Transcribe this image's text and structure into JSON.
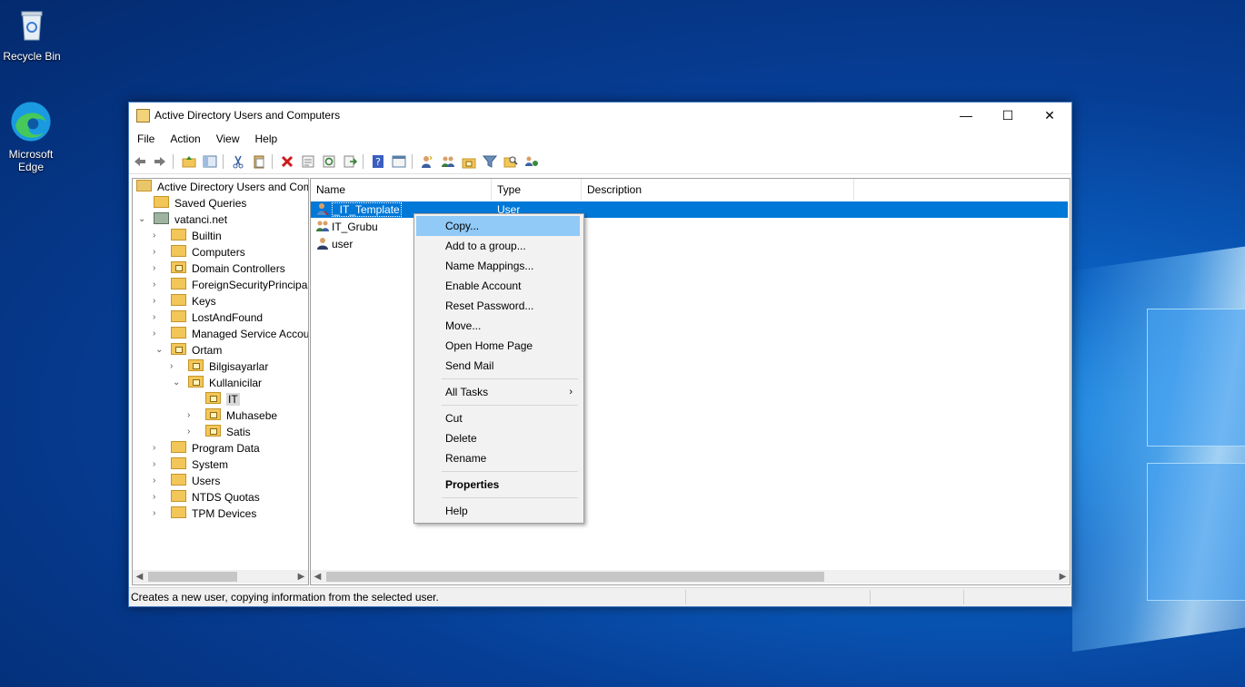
{
  "desktop": {
    "icons": [
      {
        "label": "Recycle Bin",
        "icon": "recycle-bin-icon"
      },
      {
        "label": "Microsoft Edge",
        "icon": "edge-icon"
      }
    ]
  },
  "window": {
    "title": "Active Directory Users and Computers",
    "controls": {
      "minimize": "—",
      "maximize": "☐",
      "close": "✕"
    }
  },
  "menu": [
    "File",
    "Action",
    "View",
    "Help"
  ],
  "tree": {
    "root": "Active Directory Users and Com",
    "items": [
      {
        "label": "Saved Queries"
      },
      {
        "label": "vatanci.net"
      },
      {
        "label": "Builtin"
      },
      {
        "label": "Computers"
      },
      {
        "label": "Domain Controllers"
      },
      {
        "label": "ForeignSecurityPrincipals"
      },
      {
        "label": "Keys"
      },
      {
        "label": "LostAndFound"
      },
      {
        "label": "Managed Service Accoun"
      },
      {
        "label": "Ortam"
      },
      {
        "label": "Bilgisayarlar"
      },
      {
        "label": "Kullanicilar"
      },
      {
        "label": "IT"
      },
      {
        "label": "Muhasebe"
      },
      {
        "label": "Satis"
      },
      {
        "label": "Program Data"
      },
      {
        "label": "System"
      },
      {
        "label": "Users"
      },
      {
        "label": "NTDS Quotas"
      },
      {
        "label": "TPM Devices"
      }
    ]
  },
  "list": {
    "columns": [
      "Name",
      "Type",
      "Description"
    ],
    "rows": [
      {
        "name": "_IT_Template",
        "type": "User",
        "description": ""
      },
      {
        "name": "IT_Grubu",
        "type": "",
        "description": ""
      },
      {
        "name": "user",
        "type": "",
        "description": ""
      }
    ]
  },
  "context_menu": {
    "items": [
      "Copy...",
      "Add to a group...",
      "Name Mappings...",
      "Enable Account",
      "Reset Password...",
      "Move...",
      "Open Home Page",
      "Send Mail"
    ],
    "all_tasks": "All Tasks",
    "edit_items": [
      "Cut",
      "Delete",
      "Rename"
    ],
    "properties": "Properties",
    "help": "Help"
  },
  "status": {
    "text": "Creates a new user, copying information from the selected user."
  },
  "colors": {
    "selection": "#0078d7",
    "menu_highlight": "#91c9f7",
    "desktop": "#063e96"
  }
}
